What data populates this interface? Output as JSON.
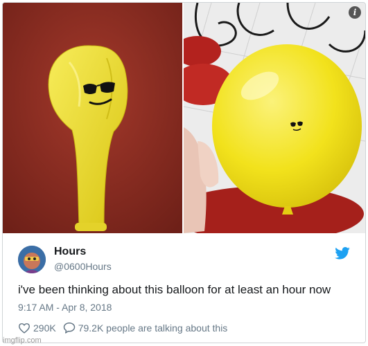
{
  "tweet": {
    "display_name": "Hours",
    "handle": "@0600Hours",
    "text": "i've been thinking about this balloon for at least an hour now",
    "timestamp": "9:17 AM - Apr 8, 2018",
    "likes": "290K",
    "talking": "79.2K people are talking about this"
  },
  "watermark": "imgflip.com",
  "colors": {
    "balloon": "#f2e21c",
    "table": "#8c2d22",
    "twitter_blue": "#1da1f2",
    "muted_text": "#657786"
  },
  "icons": [
    "info-icon",
    "twitter-bird-icon",
    "heart-icon",
    "comment-icon"
  ]
}
